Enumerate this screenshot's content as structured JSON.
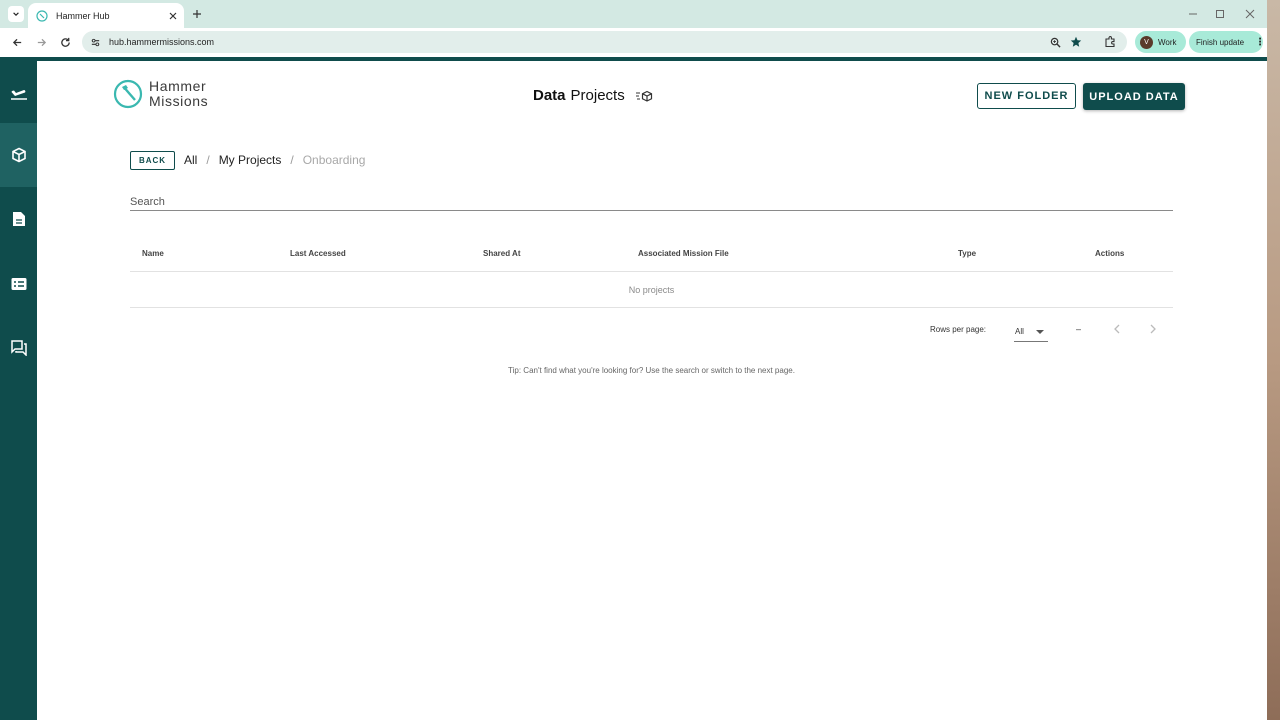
{
  "browser": {
    "tab_title": "Hammer Hub",
    "url": "hub.hammermissions.com",
    "profile_initial": "V",
    "profile_label": "Work",
    "update_label": "Finish update"
  },
  "colors": {
    "brand": "#0f4c4c",
    "brand_active": "#1f6262",
    "logo_teal": "#3ab8b0"
  },
  "sidebar": {
    "items": [
      {
        "icon": "airplane-icon"
      },
      {
        "icon": "cube-icon",
        "active": true
      },
      {
        "icon": "document-icon"
      },
      {
        "icon": "list-card-icon"
      },
      {
        "icon": "chat-icon"
      }
    ]
  },
  "header": {
    "logo_line1": "Hammer",
    "logo_line2": "Missions",
    "title_bold": "Data",
    "title_rest": "Projects",
    "new_folder_label": "NEW FOLDER",
    "upload_label": "UPLOAD DATA"
  },
  "nav": {
    "back_label": "BACK",
    "breadcrumbs": [
      "All",
      "My Projects",
      "Onboarding"
    ],
    "separator": "/"
  },
  "search": {
    "placeholder": "Search",
    "value": ""
  },
  "table": {
    "columns": [
      "Name",
      "Last Accessed",
      "Shared At",
      "Associated Mission File",
      "Type",
      "Actions"
    ],
    "rows": [],
    "empty_text": "No projects"
  },
  "pagination": {
    "rows_per_page_label": "Rows per page:",
    "rows_per_page_value": "All",
    "range_text": "–"
  },
  "tip": "Tip: Can't find what you're looking for? Use the search or switch to the next page."
}
